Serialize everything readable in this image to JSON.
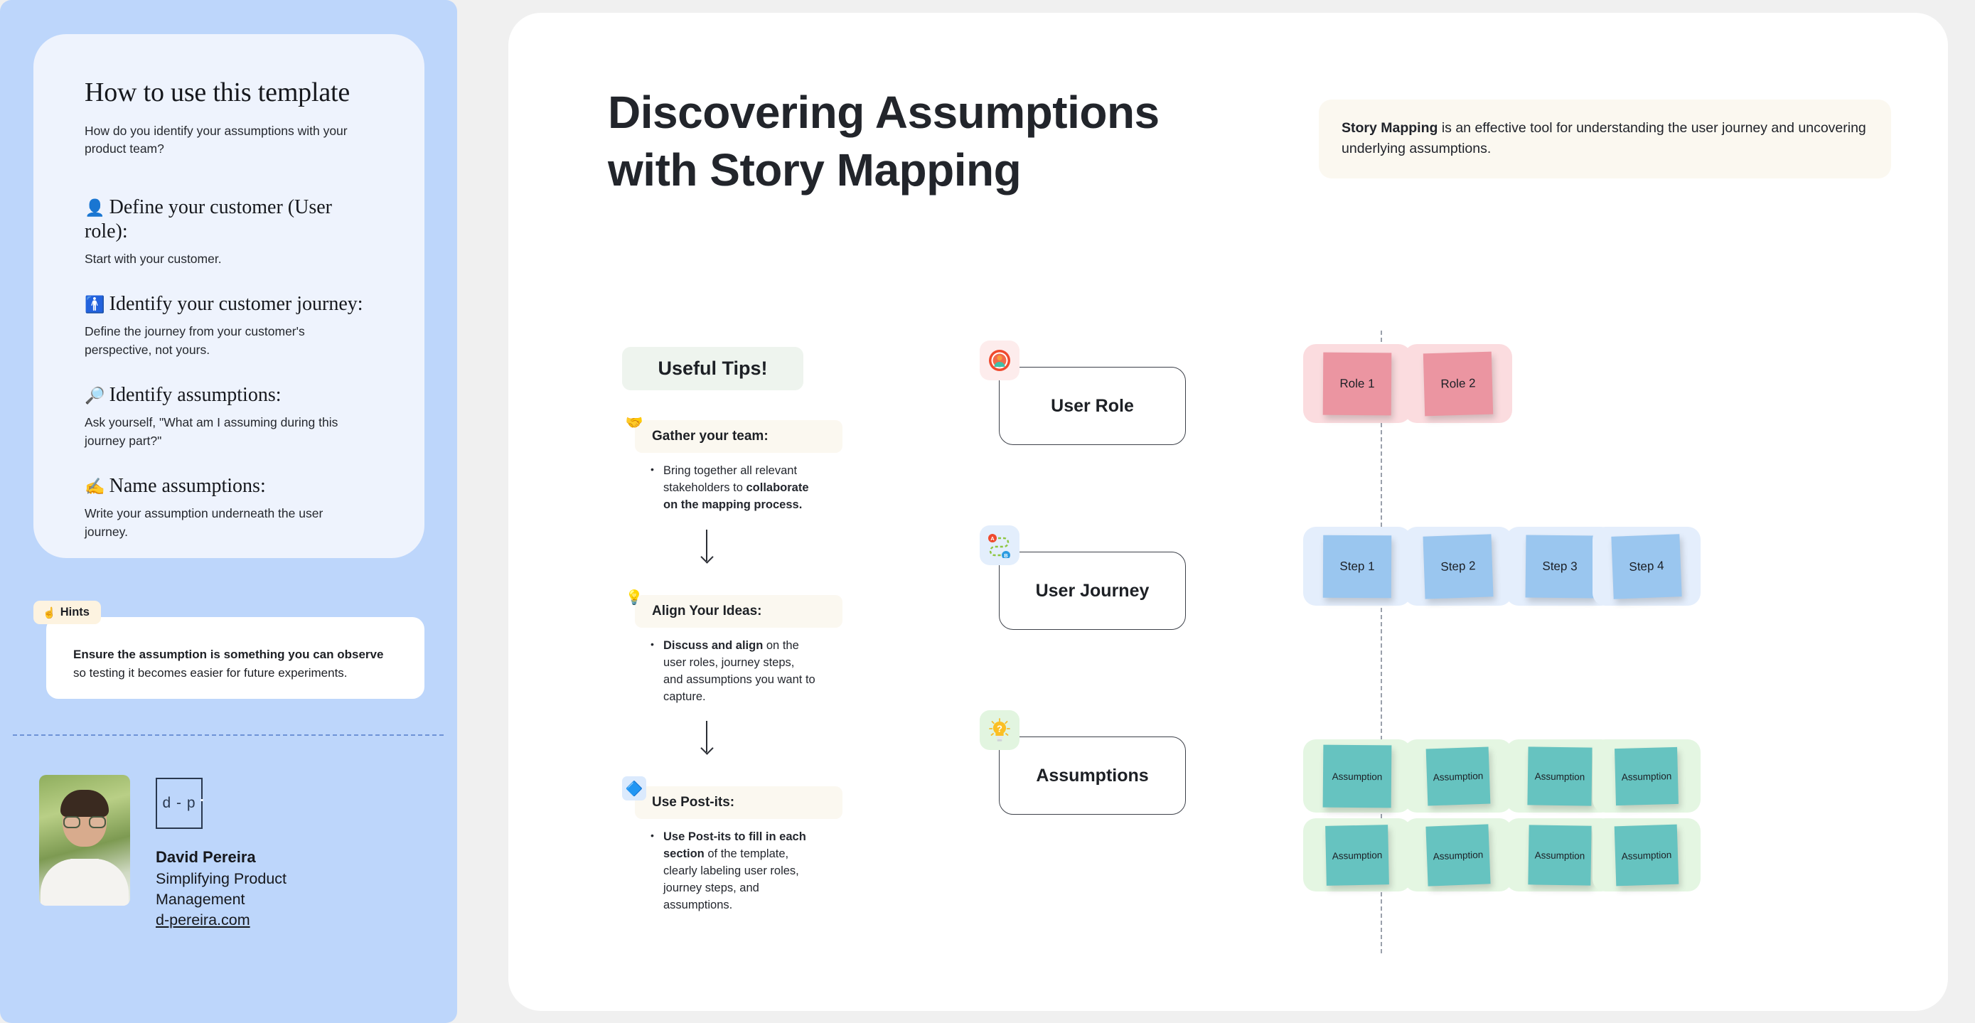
{
  "sidebar": {
    "howto": {
      "title": "How to use this template",
      "subtitle": "How do you identify your assumptions with your product team?",
      "sections": [
        {
          "emoji": "👤",
          "heading": "Define your customer (User role):",
          "body": "Start with your customer."
        },
        {
          "emoji": "🚹",
          "heading": "Identify your customer journey:",
          "body": "Define the journey from your customer's perspective, not yours."
        },
        {
          "emoji": "🔎",
          "heading": "Identify assumptions:",
          "body": "Ask yourself, \"What am I assuming during this journey part?\""
        },
        {
          "emoji": "✍️",
          "heading": "Name assumptions:",
          "body": "Write your assumption underneath the user journey."
        }
      ]
    },
    "hints": {
      "emoji": "☝️",
      "badge_label": "Hints",
      "bold_text": "Ensure the assumption is something you can observe",
      "rest_text": " so testing it becomes easier for future experiments."
    },
    "author": {
      "logo_text": "d - p",
      "name": "David Pereira",
      "role": "Simplifying Product Management",
      "link": "d-pereira.com"
    }
  },
  "main": {
    "title": "Discovering Assumptions with Story Mapping",
    "callout": {
      "bold_lead": "Story Mapping",
      "rest": " is an effective tool for understanding the user journey and uncovering underlying assumptions."
    },
    "tips": {
      "header": "Useful Tips!",
      "blocks": [
        {
          "icon": "🤝",
          "icon_name": "handshake-icon",
          "heading": "Gather your team:",
          "bullet_pre": "Bring together all relevant stakeholders to ",
          "bullet_bold": "collaborate on the mapping process.",
          "bullet_post": ""
        },
        {
          "icon": "💡",
          "icon_name": "lightbulb-icon",
          "heading": "Align Your Ideas:",
          "bullet_pre": "",
          "bullet_bold": "Discuss and align",
          "bullet_post": " on the user roles, journey steps, and assumptions you want to capture."
        },
        {
          "icon": "🔷",
          "icon_name": "postit-shapes-icon",
          "heading": "Use Post-its:",
          "bullet_pre": "",
          "bullet_bold": "Use Post-its to fill in each section",
          "bullet_post": " of the template, clearly labeling user roles, journey steps, and assumptions."
        }
      ]
    },
    "sections": [
      {
        "label": "User Role",
        "badge_icon": "👤",
        "badge_name": "user-avatar-icon",
        "badge_color": "#fdecec"
      },
      {
        "label": "User Journey",
        "badge_icon": "📍",
        "badge_name": "route-a-to-b-icon",
        "badge_color": "#e3eefc"
      },
      {
        "label": "Assumptions",
        "badge_icon": "💡",
        "badge_name": "question-bulb-icon",
        "badge_color": "#e2f5e0"
      }
    ],
    "board": {
      "roles": [
        "Role 1",
        "Role 2"
      ],
      "steps": [
        "Step 1",
        "Step 2",
        "Step 3",
        "Step 4"
      ],
      "assumptions_row1": [
        "Assumption",
        "Assumption",
        "Assumption",
        "Assumption"
      ],
      "assumptions_row2": [
        "Assumption",
        "Assumption",
        "Assumption",
        "Assumption"
      ]
    }
  },
  "colors": {
    "sidebar_bg": "#bdd6fb",
    "card_bg": "#eef3fd",
    "canvas_bg": "#ffffff",
    "page_bg": "#f0f0f0",
    "note_pink": "#eb95a1",
    "note_blue": "#9ac6ef",
    "note_green": "#66c3c0",
    "cell_pink": "#fbdcdf",
    "cell_blue": "#e4eefc",
    "cell_green": "#e4f6e2",
    "callout_bg": "#fbf8f0",
    "tips_header_bg": "#eef4ee"
  }
}
